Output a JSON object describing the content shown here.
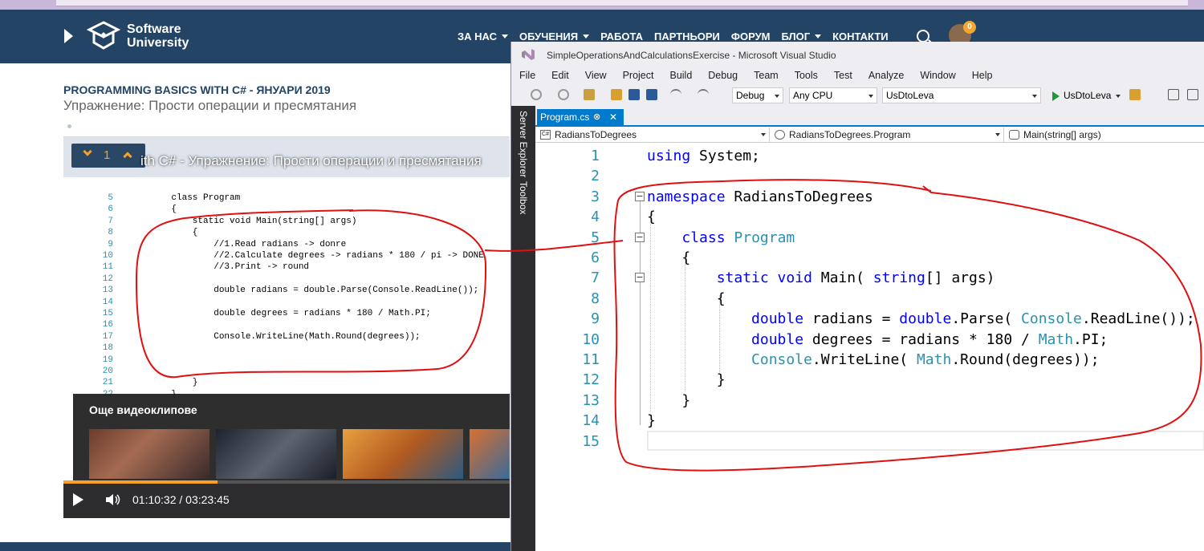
{
  "site": {
    "logo_line1": "Software",
    "logo_line2": "University",
    "nav": [
      {
        "label": "ЗА НАС",
        "dropdown": true
      },
      {
        "label": "ОБУЧЕНИЯ",
        "dropdown": true
      },
      {
        "label": "РАБОТА",
        "dropdown": false
      },
      {
        "label": "ПАРТНЬОРИ",
        "dropdown": false
      },
      {
        "label": "ФОРУМ",
        "dropdown": false
      },
      {
        "label": "БЛОГ",
        "dropdown": true
      },
      {
        "label": "КОНТАКТИ",
        "dropdown": false
      }
    ],
    "notification_count": "0",
    "brand_color": "#234465",
    "accent_color": "#f6a028"
  },
  "course": {
    "title": "PROGRAMMING BASICS WITH C# - ЯНУАРИ 2019",
    "subtitle": "Упражнение: Прости операции и пресмятания"
  },
  "video": {
    "overlay_title": "ith C# - Упражнение: Прости операции и пресмятания",
    "chapter_number": "1",
    "more_videos_label": "Още видеоклипове",
    "time": "01:10:32 / 03:23:45",
    "progress_fraction": 0.346,
    "code_lines": [
      {
        "n": "5",
        "t": "    class Program"
      },
      {
        "n": "6",
        "t": "    {"
      },
      {
        "n": "7",
        "t": "        static void Main(string[] args)"
      },
      {
        "n": "8",
        "t": "        {"
      },
      {
        "n": "9",
        "t": "            //1.Read radians -> donre"
      },
      {
        "n": "10",
        "t": "            //2.Calculate degrees -> radians * 180 / pi -> DONE"
      },
      {
        "n": "11",
        "t": "            //3.Print -> round"
      },
      {
        "n": "12",
        "t": ""
      },
      {
        "n": "13",
        "t": "            double radians = double.Parse(Console.ReadLine());"
      },
      {
        "n": "14",
        "t": ""
      },
      {
        "n": "15",
        "t": "            double degrees = radians * 180 / Math.PI;"
      },
      {
        "n": "16",
        "t": ""
      },
      {
        "n": "17",
        "t": "            Console.WriteLine(Math.Round(degrees));"
      },
      {
        "n": "18",
        "t": ""
      },
      {
        "n": "19",
        "t": ""
      },
      {
        "n": "20",
        "t": ""
      },
      {
        "n": "21",
        "t": "        }"
      },
      {
        "n": "22",
        "t": "    }"
      }
    ]
  },
  "vs": {
    "window_title": "SimpleOperationsAndCalculationsExercise - Microsoft Visual Studio",
    "menu": [
      "File",
      "Edit",
      "View",
      "Project",
      "Build",
      "Debug",
      "Team",
      "Tools",
      "Test",
      "Analyze",
      "Window",
      "Help"
    ],
    "config": "Debug",
    "platform": "Any CPU",
    "startup_project": "UsDtoLeva",
    "run_label": "UsDtoLeva",
    "side_tabs": [
      "Server Explorer",
      "Toolbox"
    ],
    "tab_name": "Program.cs",
    "nav_project": "RadiansToDegrees",
    "nav_class": "RadiansToDegrees.Program",
    "nav_member": "Main(string[] args)",
    "code": [
      {
        "n": "1",
        "fold": false,
        "parts": [
          [
            "kw",
            "using"
          ],
          [
            "",
            "System;"
          ]
        ]
      },
      {
        "n": "2",
        "fold": false,
        "parts": []
      },
      {
        "n": "3",
        "fold": true,
        "parts": [
          [
            "kw",
            "namespace"
          ],
          [
            "",
            " RadiansToDegrees"
          ]
        ]
      },
      {
        "n": "4",
        "fold": false,
        "parts": [
          [
            "",
            "{"
          ]
        ]
      },
      {
        "n": "5",
        "fold": true,
        "parts": [
          [
            "",
            "    "
          ],
          [
            "kw",
            "class"
          ],
          [
            "",
            ""
          ],
          [
            "ty",
            "Program"
          ]
        ]
      },
      {
        "n": "6",
        "fold": false,
        "parts": [
          [
            "",
            "    {"
          ]
        ]
      },
      {
        "n": "7",
        "fold": true,
        "parts": [
          [
            "",
            "        "
          ],
          [
            "kw",
            "static void"
          ],
          [
            "",
            " Main("
          ],
          [
            "kw",
            "string"
          ],
          [
            "",
            "[] args)"
          ]
        ]
      },
      {
        "n": "8",
        "fold": false,
        "parts": [
          [
            "",
            "        {"
          ]
        ]
      },
      {
        "n": "9",
        "fold": false,
        "parts": [
          [
            "",
            "            "
          ],
          [
            "kw",
            "double"
          ],
          [
            "",
            " radians = "
          ],
          [
            "kw",
            "double"
          ],
          [
            "",
            ".Parse("
          ],
          [
            "ty",
            "Console"
          ],
          [
            "",
            ".ReadLine());"
          ]
        ]
      },
      {
        "n": "10",
        "fold": false,
        "parts": [
          [
            "",
            "            "
          ],
          [
            "kw",
            "double"
          ],
          [
            "",
            " degrees = radians * 180 / "
          ],
          [
            "ty",
            "Math"
          ],
          [
            "",
            ".PI;"
          ]
        ]
      },
      {
        "n": "11",
        "fold": false,
        "parts": [
          [
            "",
            "            "
          ],
          [
            "ty",
            "Console"
          ],
          [
            "",
            ".WriteLine("
          ],
          [
            "ty",
            "Math"
          ],
          [
            "",
            ".Round(degrees));"
          ]
        ]
      },
      {
        "n": "12",
        "fold": false,
        "parts": [
          [
            "",
            "        }"
          ]
        ]
      },
      {
        "n": "13",
        "fold": false,
        "parts": [
          [
            "",
            "    }"
          ]
        ]
      },
      {
        "n": "14",
        "fold": false,
        "parts": [
          [
            "",
            "}"
          ]
        ]
      },
      {
        "n": "15",
        "fold": false,
        "parts": []
      }
    ],
    "keyword_color": "#0000ff",
    "type_color": "#2b91af",
    "tab_color": "#007acc"
  }
}
